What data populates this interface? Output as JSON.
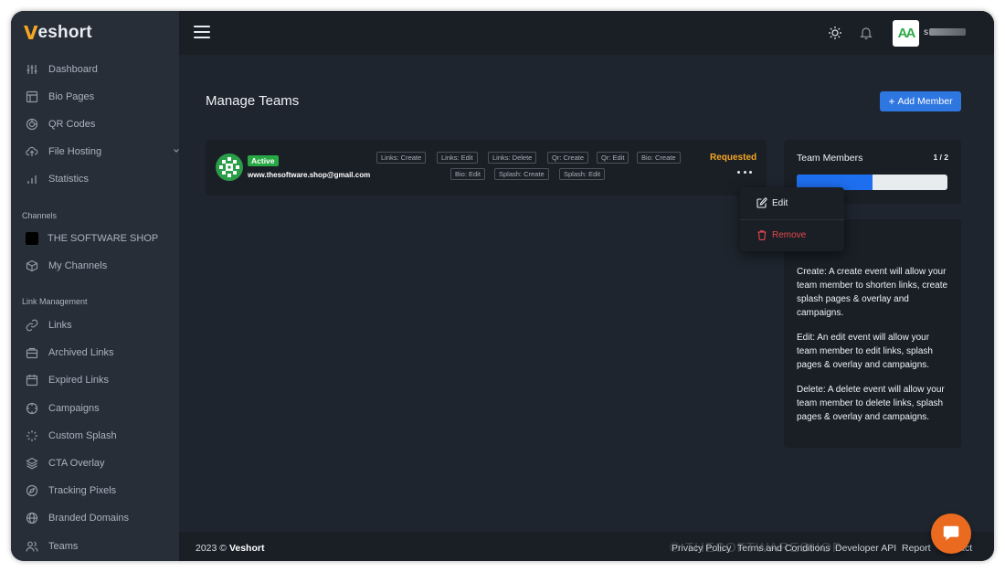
{
  "app": {
    "logo_mark": "V",
    "logo_text": "eshort"
  },
  "sidebar": {
    "items_top": [
      {
        "label": "Dashboard",
        "icon": "sliders-icon"
      },
      {
        "label": "Bio Pages",
        "icon": "layout-icon"
      },
      {
        "label": "QR Codes",
        "icon": "qr-icon"
      },
      {
        "label": "File Hosting",
        "icon": "cloud-upload-icon"
      },
      {
        "label": "Statistics",
        "icon": "bar-chart-icon"
      }
    ],
    "channels_header": "Channels",
    "channels": [
      {
        "label": "THE SOFTWARE SHOP"
      },
      {
        "label": "My Channels",
        "icon": "box-icon"
      }
    ],
    "link_mgmt_header": "Link Management",
    "items_links": [
      {
        "label": "Links",
        "icon": "link-icon"
      },
      {
        "label": "Archived Links",
        "icon": "archive-icon"
      },
      {
        "label": "Expired Links",
        "icon": "calendar-icon"
      },
      {
        "label": "Campaigns",
        "icon": "crosshair-icon"
      },
      {
        "label": "Custom Splash",
        "icon": "loader-icon"
      },
      {
        "label": "CTA Overlay",
        "icon": "layers-icon"
      },
      {
        "label": "Tracking Pixels",
        "icon": "compass-icon"
      },
      {
        "label": "Branded Domains",
        "icon": "globe-icon"
      },
      {
        "label": "Teams",
        "icon": "users-icon"
      }
    ]
  },
  "topbar": {
    "avatar_text": "AA",
    "user_initial": "s"
  },
  "main": {
    "title": "Manage Teams",
    "add_member_label": "Add Member",
    "member": {
      "status": "Active",
      "email": "www.thesoftware.shop@gmail.com",
      "state": "Requested",
      "permissions_row1": [
        "Links: Create",
        "Links: Edit",
        "Links: Delete",
        "Qr: Create",
        "Qr: Edit",
        "Bio: Create"
      ],
      "permissions_row2": [
        "Bio: Edit",
        "Splash: Create",
        "Splash: Edit"
      ]
    },
    "dropdown": {
      "edit_label": "Edit",
      "remove_label": "Remove"
    },
    "team_members": {
      "title": "Team Members",
      "count": "1 / 2",
      "progress": 0.5
    },
    "permission_panel": {
      "title_visible": "on",
      "create_text": "Create: A create event will allow your team member to shorten links, create splash pages & overlay and campaigns.",
      "edit_text": "Edit: An edit event will allow your team member to edit links, splash pages & overlay and campaigns.",
      "delete_text": "Delete: A delete event will allow your team member to delete links, splash pages & overlay and campaigns."
    }
  },
  "footer": {
    "year": "2023 ©",
    "brand": "Veshort",
    "links": [
      "Privacy Policy",
      "Terms and Conditions",
      "Developer API",
      "Report",
      "Contact"
    ]
  },
  "watermark": "© THESOFTWARESHOP",
  "colors": {
    "accent": "#2f77e0",
    "brand": "#f5a623",
    "active": "#27a844",
    "danger": "#e5484d",
    "chat": "#ea6a1f"
  }
}
